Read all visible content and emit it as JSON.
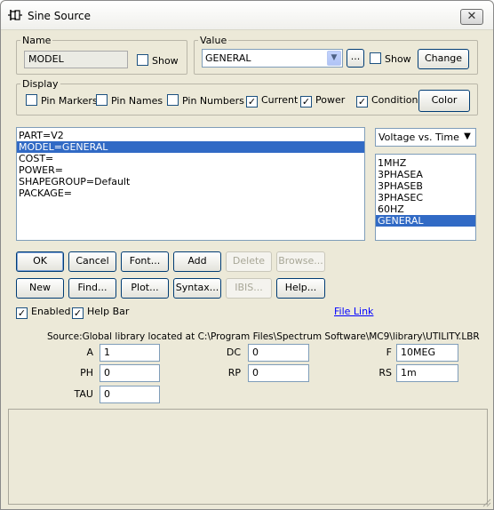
{
  "window": {
    "title": "Sine Source",
    "title_icon": "sine-source-symbol-icon"
  },
  "name_group": {
    "legend": "Name",
    "value": "MODEL",
    "show_label": "Show",
    "show_checked": false
  },
  "value_group": {
    "legend": "Value",
    "selected": "GENERAL",
    "ellipsis_label": "...",
    "show_label": "Show",
    "show_checked": false,
    "change_label": "Change"
  },
  "display_group": {
    "legend": "Display",
    "options": [
      {
        "label": "Pin Markers",
        "checked": false
      },
      {
        "label": "Pin Names",
        "checked": false
      },
      {
        "label": "Pin Numbers",
        "checked": false
      },
      {
        "label": "Current",
        "checked": true
      },
      {
        "label": "Power",
        "checked": true
      },
      {
        "label": "Condition",
        "checked": true
      }
    ],
    "color_label": "Color"
  },
  "attributes": {
    "items": [
      "PART=V2",
      "MODEL=GENERAL",
      "COST=",
      "POWER=",
      "SHAPEGROUP=Default",
      "PACKAGE="
    ],
    "selected_index": 1
  },
  "plot_mode": {
    "selected": "Voltage vs. Time"
  },
  "models": {
    "items": [
      "1MHZ",
      "3PHASEA",
      "3PHASEB",
      "3PHASEC",
      "60HZ",
      "GENERAL"
    ],
    "selected_index": 5
  },
  "buttons_row1": [
    {
      "label": "OK",
      "enabled": true
    },
    {
      "label": "Cancel",
      "enabled": true
    },
    {
      "label": "Font...",
      "enabled": true
    },
    {
      "label": "Add",
      "enabled": true
    },
    {
      "label": "Delete",
      "enabled": false
    },
    {
      "label": "Browse...",
      "enabled": false
    }
  ],
  "buttons_row2": [
    {
      "label": "New",
      "enabled": true
    },
    {
      "label": "Find...",
      "enabled": true
    },
    {
      "label": "Plot...",
      "enabled": true
    },
    {
      "label": "Syntax...",
      "enabled": true
    },
    {
      "label": "IBIS...",
      "enabled": false
    },
    {
      "label": "Help...",
      "enabled": true
    }
  ],
  "options": {
    "enabled_label": "Enabled",
    "enabled_checked": true,
    "help_bar_label": "Help Bar",
    "help_bar_checked": true,
    "file_link_label": "File Link"
  },
  "source_text": "Source:Global library located at C:\\Program Files\\Spectrum Software\\MC9\\library\\UTILITY.LBR",
  "params": [
    {
      "name": "A",
      "value": "1"
    },
    {
      "name": "DC",
      "value": "0"
    },
    {
      "name": "F",
      "value": "10MEG"
    },
    {
      "name": "PH",
      "value": "0"
    },
    {
      "name": "RP",
      "value": "0"
    },
    {
      "name": "RS",
      "value": "1m"
    },
    {
      "name": "TAU",
      "value": "0"
    }
  ],
  "help_text": ""
}
